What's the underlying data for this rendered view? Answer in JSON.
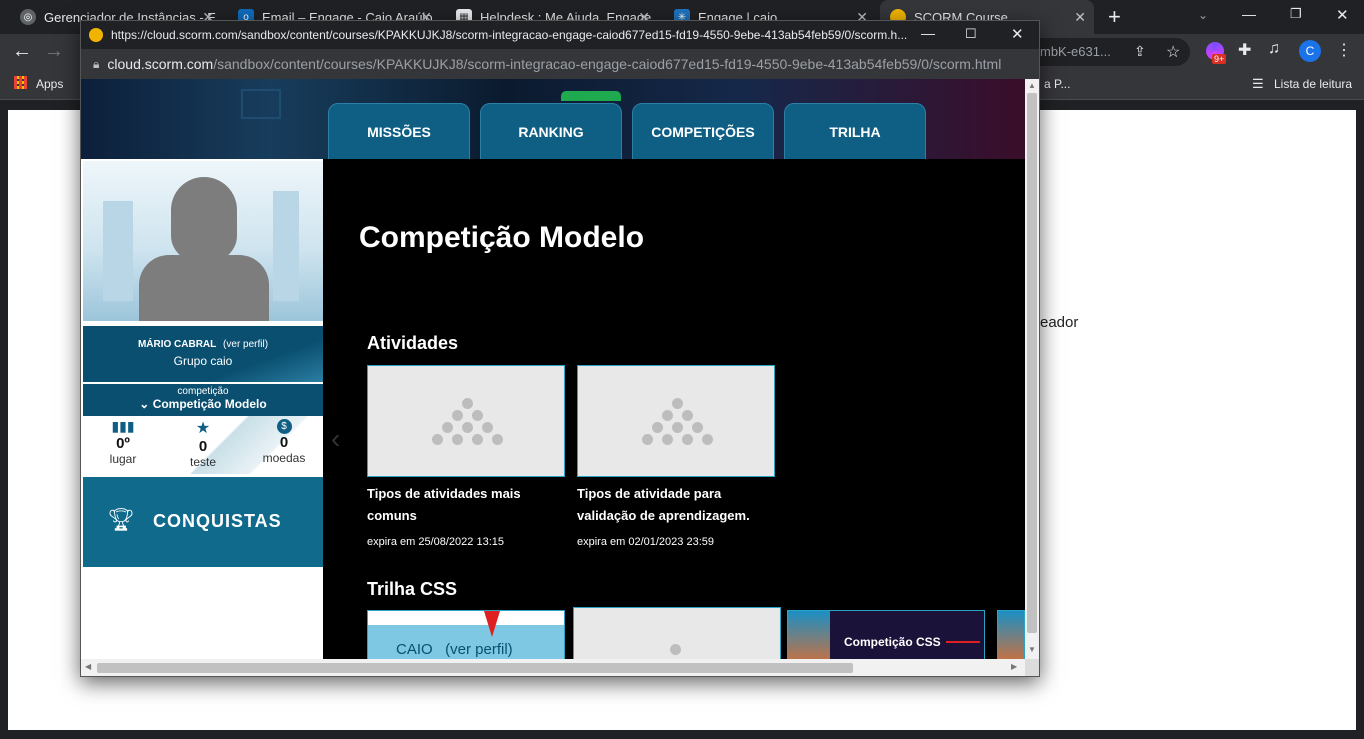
{
  "browser": {
    "tabs": [
      {
        "title": "Gerenciador de Instâncias - E",
        "favicon_color": "#8ab4f8"
      },
      {
        "title": "Email – Engage - Caio Araújo",
        "favicon_color": "#0f6cbd"
      },
      {
        "title": "Helpdesk : Me Ajuda, Engage",
        "favicon_color": "#5f6368"
      },
      {
        "title": "Engage | caio",
        "favicon_color": "#1e73be"
      },
      {
        "title": "SCORM Course",
        "favicon_color": "#f0b400"
      }
    ],
    "new_tab": "+",
    "omnibox_partial": "mbK-e631...",
    "extension_badge": "9+",
    "profile_initial": "C",
    "bookmarks": {
      "apps": "Apps",
      "partial": "a P...",
      "reading_list": "Lista de leitura"
    },
    "page_text_partial": "eador"
  },
  "popup": {
    "title_url": "https://cloud.scorm.com/sandbox/content/courses/KPAKKUJKJ8/scorm-integracao-engage-caiod677ed15-fd19-4550-9ebe-413ab54feb59/0/scorm.h...",
    "address_host": "cloud.scorm.com",
    "address_path": "/sandbox/content/courses/KPAKKUJKJ8/scorm-integracao-engage-caiod677ed15-fd19-4550-9ebe-413ab54feb59/0/scorm.html"
  },
  "nav": {
    "tabs": [
      "MISSÕES",
      "RANKING",
      "COMPETIÇÕES",
      "TRILHA"
    ]
  },
  "profile": {
    "name": "MÁRIO CABRAL",
    "profile_link": "(ver perfil)",
    "group": "Grupo caio",
    "competition_label": "competição",
    "competition_name": "Competição Modelo",
    "stats": [
      {
        "value": "0º",
        "label": "lugar",
        "icon": "bar-chart-icon"
      },
      {
        "value": "0",
        "label": "teste",
        "icon": "star-icon"
      },
      {
        "value": "0",
        "label": "moedas",
        "icon": "coin-icon"
      }
    ],
    "achievements_label": "CONQUISTAS"
  },
  "main": {
    "title": "Competição Modelo",
    "activities_heading": "Atividades",
    "activities": [
      {
        "title": "Tipos de atividades mais comuns",
        "expires": "expira em 25/08/2022 13:15"
      },
      {
        "title": "Tipos de atividade para validação de aprendizagem.",
        "expires": "expira em 02/01/2023 23:59"
      }
    ],
    "trail_heading": "Trilha CSS",
    "trail_cards": [
      {
        "caption": "CAIO   (ver perfil)"
      },
      {
        "caption": ""
      },
      {
        "caption": "Competição CSS"
      }
    ]
  },
  "colors": {
    "brand": "#0f5f84",
    "accent": "#2aa3c4",
    "sidebar_dark": "#0a4f70"
  }
}
